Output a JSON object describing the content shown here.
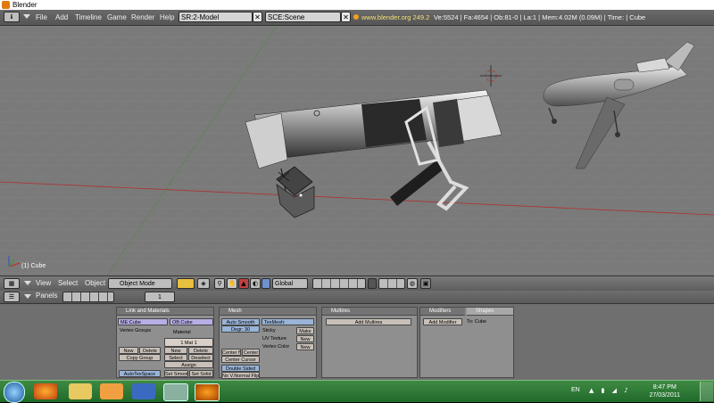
{
  "window": {
    "title": "Blender"
  },
  "topbar": {
    "menus": [
      "File",
      "Add",
      "Timeline",
      "Game",
      "Render",
      "Help"
    ],
    "screen_field": "SR:2-Model",
    "scene_field": "SCE:Scene",
    "website": "www.blender.org 249.2",
    "stats": "Ve:5524 | Fa:4654 | Ob:81-0 | La:1 | Mem:4.02M (0.09M) | Time: | Cube"
  },
  "viewport": {
    "object_label": "(1) Cube"
  },
  "view_header": {
    "menus": [
      "View",
      "Select",
      "Object"
    ],
    "mode": "Object Mode",
    "orientation": "Global"
  },
  "panels_header": {
    "label": "Panels",
    "page": "1"
  },
  "link_materials": {
    "title": "Link and Materials",
    "me_field": "ME:Cube",
    "ob_field": "OB:Cube",
    "vertex_groups": "Vertex Groups",
    "material": "Material",
    "mat_index": "1 Mat 1",
    "new": "New",
    "delete": "Delete",
    "copy_group": "Copy Group",
    "select": "Select",
    "deselect": "Deselect",
    "assign": "Assign",
    "autotexspace": "AutoTexSpace",
    "set_smooth": "Set Smooth",
    "set_solid": "Set Solid"
  },
  "mesh": {
    "title": "Mesh",
    "auto_smooth": "Auto Smooth",
    "degr": "Degr: 30",
    "texmesh": "TexMesh:",
    "sticky": "Sticky",
    "make": "Make",
    "uv_texture": "UV Texture",
    "new1": "New",
    "vertex_color": "Vertex Color",
    "new2": "New",
    "center_new": "Center New",
    "center": "Center",
    "center_cursor": "Center Cursor",
    "double_sided": "Double Sided",
    "no_v_normal_flip": "No V.Normal Flip"
  },
  "multires": {
    "title": "Multires",
    "add_button": "Add Multires"
  },
  "modifiers": {
    "tab1": "Modifiers",
    "tab2": "Shapes",
    "add_modifier": "Add Modifier",
    "to": "To: Cube"
  },
  "taskbar": {
    "lang": "EN",
    "time": "8:47 PM",
    "date": "27/03/2011"
  },
  "colors": {
    "grid_x_axis": "#b03030",
    "grid_y_axis": "#4a8a30",
    "taskbar": "#2f7a36"
  }
}
